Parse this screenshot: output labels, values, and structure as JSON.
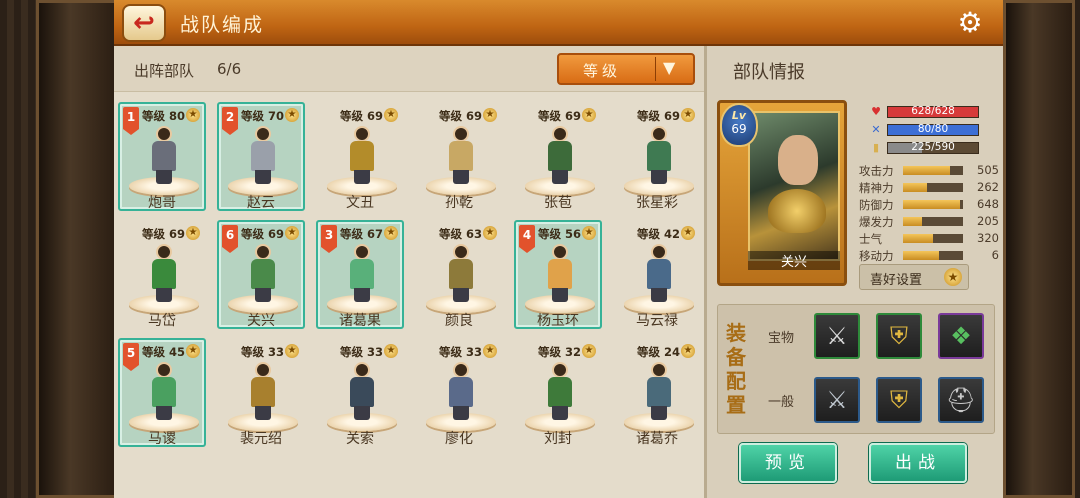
{
  "header": {
    "title": "战队编成"
  },
  "roster": {
    "deploy_label": "出阵部队",
    "deploy_count": "6/6",
    "sort": {
      "selected": "等级"
    },
    "level_prefix": "等级",
    "units": [
      {
        "name": "炮哥",
        "level": "80",
        "slot": "1",
        "selected": true,
        "color": "#6a6e7a"
      },
      {
        "name": "赵云",
        "level": "70",
        "slot": "2",
        "selected": true,
        "color": "#9aa0aa"
      },
      {
        "name": "文丑",
        "level": "69",
        "slot": "",
        "selected": false,
        "color": "#b38c2a"
      },
      {
        "name": "孙乾",
        "level": "69",
        "slot": "",
        "selected": false,
        "color": "#c8a864"
      },
      {
        "name": "张苞",
        "level": "69",
        "slot": "",
        "selected": false,
        "color": "#3d6b3a"
      },
      {
        "name": "张星彩",
        "level": "69",
        "slot": "",
        "selected": false,
        "color": "#3f7a52"
      },
      {
        "name": "马岱",
        "level": "69",
        "slot": "",
        "selected": false,
        "color": "#3a8a3c"
      },
      {
        "name": "关兴",
        "level": "69",
        "slot": "6",
        "selected": true,
        "color": "#4a8a4a"
      },
      {
        "name": "诸葛果",
        "level": "67",
        "slot": "3",
        "selected": true,
        "color": "#59b07a"
      },
      {
        "name": "颜良",
        "level": "63",
        "slot": "",
        "selected": false,
        "color": "#8d7a3a"
      },
      {
        "name": "杨玉环",
        "level": "56",
        "slot": "4",
        "selected": true,
        "color": "#e0a24a"
      },
      {
        "name": "马云禄",
        "level": "42",
        "slot": "",
        "selected": false,
        "color": "#4a6a8a"
      },
      {
        "name": "马谡",
        "level": "45",
        "slot": "5",
        "selected": true,
        "color": "#4aa060"
      },
      {
        "name": "裴元绍",
        "level": "33",
        "slot": "",
        "selected": false,
        "color": "#a8802e"
      },
      {
        "name": "关索",
        "level": "33",
        "slot": "",
        "selected": false,
        "color": "#3a4a5a"
      },
      {
        "name": "廖化",
        "level": "33",
        "slot": "",
        "selected": false,
        "color": "#5a6a8a"
      },
      {
        "name": "刘封",
        "level": "32",
        "slot": "",
        "selected": false,
        "color": "#3e7a3a"
      },
      {
        "name": "诸葛乔",
        "level": "24",
        "slot": "",
        "selected": false,
        "color": "#4a6a7a"
      }
    ]
  },
  "info": {
    "title": "部队情报",
    "hero": {
      "name": "关兴",
      "lv_label": "Lv",
      "level": "69"
    },
    "resources": [
      {
        "icon": "heart-icon",
        "glyph": "♥",
        "color": "#d83030",
        "text": "628/628",
        "fill": 1.0,
        "bar": "#d63a3a"
      },
      {
        "icon": "sword-icon",
        "glyph": "✕",
        "color": "#3a6ad0",
        "text": "80/80",
        "fill": 1.0,
        "bar": "#3d6fd6"
      },
      {
        "icon": "book-icon",
        "glyph": "▮",
        "color": "#d8b050",
        "text": "225/590",
        "fill": 0.38,
        "bar": "#8a8a8a"
      }
    ],
    "stats": [
      {
        "label": "攻击力",
        "value": "505",
        "fill": 0.78
      },
      {
        "label": "精神力",
        "value": "262",
        "fill": 0.4
      },
      {
        "label": "防御力",
        "value": "648",
        "fill": 0.95
      },
      {
        "label": "爆发力",
        "value": "205",
        "fill": 0.32
      },
      {
        "label": "士气",
        "value": "320",
        "fill": 0.5
      },
      {
        "label": "移动力",
        "value": "6",
        "fill": 0.6
      }
    ],
    "preference_label": "喜好设置",
    "equipment": {
      "title": "装备配置",
      "treasure_label": "宝物",
      "general_label": "一般",
      "treasure": [
        {
          "icon": "blade-icon",
          "glyph": "⚔",
          "tier": "green"
        },
        {
          "icon": "armor-icon",
          "glyph": "⛨",
          "tier": "green"
        },
        {
          "icon": "book-icon",
          "glyph": "❖",
          "tier": "purple"
        }
      ],
      "general": [
        {
          "icon": "sword-icon",
          "glyph": "⚔",
          "tier": "blue"
        },
        {
          "icon": "armor-icon",
          "glyph": "⛨",
          "tier": "blue"
        },
        {
          "icon": "helmet-icon",
          "glyph": "⛑",
          "tier": "blue"
        }
      ]
    },
    "preview_label": "预览",
    "battle_label": "出战"
  }
}
